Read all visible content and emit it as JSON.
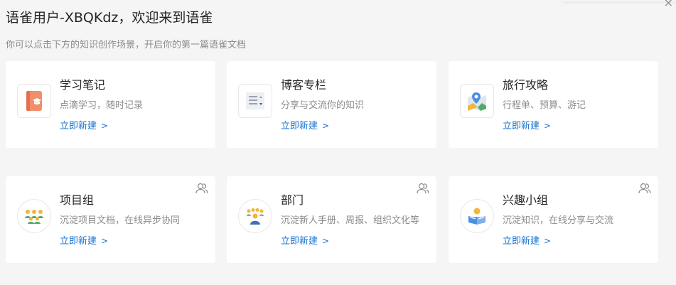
{
  "header": {
    "title": "语雀用户-XBQKdz，欢迎来到语雀",
    "subtitle": "你可以点击下方的知识创作场景，开启你的第一篇语雀文档",
    "close_glyph": "×"
  },
  "cards": [
    {
      "name": "学习笔记",
      "desc": "点滴学习，随时记录",
      "link": "立即新建",
      "icon": "notebook-icon"
    },
    {
      "name": "博客专栏",
      "desc": "分享与交流你的知识",
      "link": "立即新建",
      "icon": "blog-document-icon"
    },
    {
      "name": "旅行攻略",
      "desc": "行程单、预算、游记",
      "link": "立即新建",
      "icon": "map-pin-icon"
    },
    {
      "name": "项目组",
      "desc": "沉淀项目文档，在线异步协同",
      "link": "立即新建",
      "icon": "team-people-icon",
      "group_badge": "group-icon"
    },
    {
      "name": "部门",
      "desc": "沉淀新人手册、周报、组织文化等",
      "link": "立即新建",
      "icon": "department-people-icon",
      "group_badge": "group-icon"
    },
    {
      "name": "兴趣小组",
      "desc": "沉淀知识，在线分享与交流",
      "link": "立即新建",
      "icon": "reading-person-icon",
      "group_badge": "group-icon"
    }
  ],
  "link_chevron": ">",
  "colors": {
    "link": "#1772d0",
    "muted": "#8c8c8c",
    "background": "#f5f5f5"
  }
}
